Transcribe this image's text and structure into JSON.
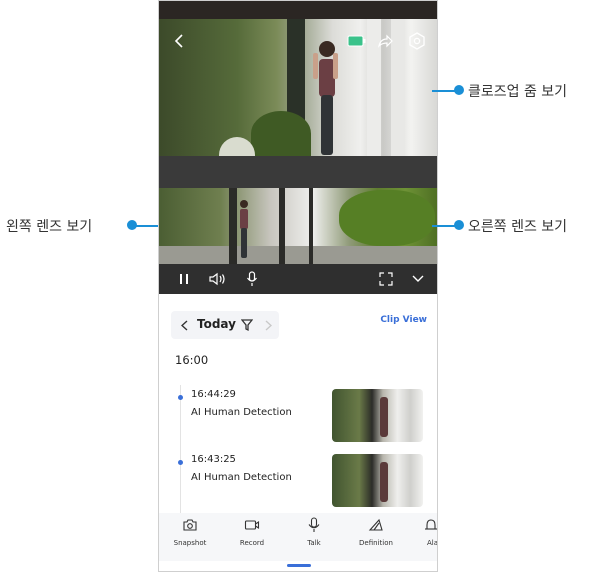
{
  "callouts": {
    "closeup": "클로즈업 줌 보기",
    "left_lens": "왼쪽 렌즈 보기",
    "right_lens": "오른쪽 렌즈 보기"
  },
  "timeline": {
    "date_label": "Today",
    "clip_view": "Clip View",
    "hour": "16:00",
    "events": [
      {
        "time": "16:44:29",
        "type": "AI Human Detection"
      },
      {
        "time": "16:43:25",
        "type": "AI Human Detection"
      }
    ]
  },
  "toolbar": {
    "snapshot": "Snapshot",
    "record": "Record",
    "talk": "Talk",
    "definition": "Definition",
    "alarm_partial": "Ala"
  },
  "colors": {
    "accent": "#3a6fd8",
    "callout": "#1a8fd6",
    "battery": "#3ac28a"
  },
  "icons": [
    "back-icon",
    "battery-icon",
    "share-icon",
    "settings-icon",
    "pause-icon",
    "speaker-icon",
    "mic-icon",
    "fullscreen-icon",
    "chevron-down-icon",
    "filter-icon",
    "camera-icon",
    "record-icon",
    "definition-icon",
    "alarm-icon"
  ]
}
